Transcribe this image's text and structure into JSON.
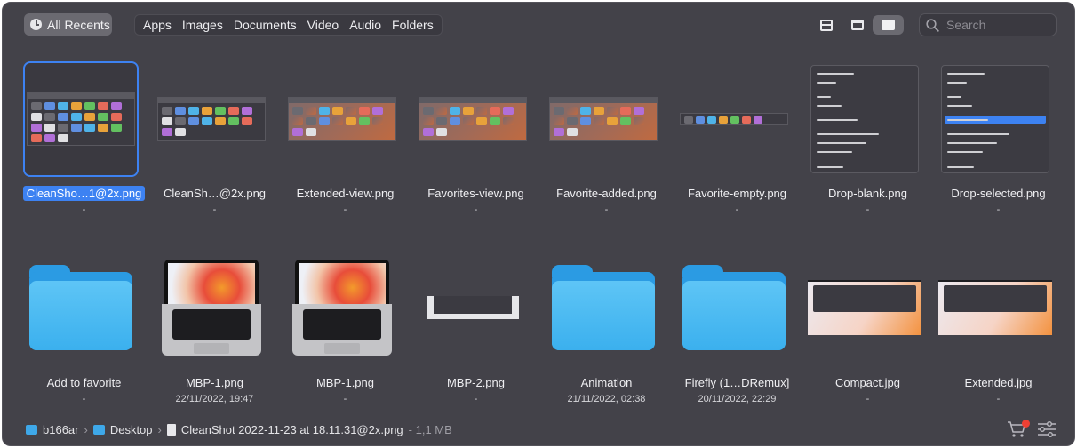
{
  "toolbar": {
    "recents_label": "All Recents",
    "filters": [
      "Apps",
      "Images",
      "Documents",
      "Video",
      "Audio",
      "Folders"
    ],
    "search_placeholder": "Search",
    "active_view": "large-thumbnails"
  },
  "items": [
    {
      "name": "CleanSho…1@2x.png",
      "sub": "-",
      "kind": "shot-icons",
      "selected": true
    },
    {
      "name": "CleanSh…@2x.png",
      "sub": "-",
      "kind": "shot"
    },
    {
      "name": "Extended-view.png",
      "sub": "-",
      "kind": "shot-warm"
    },
    {
      "name": "Favorites-view.png",
      "sub": "-",
      "kind": "shot-warm"
    },
    {
      "name": "Favorite-added.png",
      "sub": "-",
      "kind": "shot-warm"
    },
    {
      "name": "Favorite-empty.png",
      "sub": "-",
      "kind": "strip"
    },
    {
      "name": "Drop-blank.png",
      "sub": "-",
      "kind": "context-menu"
    },
    {
      "name": "Drop-selected.png",
      "sub": "-",
      "kind": "context-menu-highlight"
    },
    {
      "name": "Add to favorite",
      "sub": "-",
      "kind": "folder"
    },
    {
      "name": "MBP-1.png",
      "sub": "22/11/2022, 19:47",
      "kind": "laptop"
    },
    {
      "name": "MBP-1.png",
      "sub": "-",
      "kind": "laptop"
    },
    {
      "name": "MBP-2.png",
      "sub": "-",
      "kind": "flat"
    },
    {
      "name": "Animation",
      "sub": "21/11/2022, 02:38",
      "kind": "folder"
    },
    {
      "name": "Firefly (1…DRemux]",
      "sub": "20/11/2022, 22:29",
      "kind": "folder"
    },
    {
      "name": "Compact.jpg",
      "sub": "-",
      "kind": "wide"
    },
    {
      "name": "Extended.jpg",
      "sub": "-",
      "kind": "wide"
    }
  ],
  "context_menu": [
    "Show in Finder",
    "Open",
    "Copy",
    "Copy path",
    "Add to Favorites",
    "Ignore files with extension: .png",
    "Ignore file: MBP-1.png",
    "Ignore files in",
    "Move to Bin"
  ],
  "pathbar": {
    "segments": [
      "b166ar",
      "Desktop"
    ],
    "file": "CleanShot 2022-11-23 at 18.11.31@2x.png",
    "size": " - 1,1 MB"
  },
  "colors": {
    "background": "#434249",
    "selection": "#3d82f2",
    "folder": "#3bb0ee",
    "badge": "#ee4034"
  },
  "icons": [
    "clock-icon",
    "rows-view-icon",
    "top-bar-view-icon",
    "thumbnail-view-icon",
    "search-icon",
    "folder-icon",
    "document-icon",
    "cart-icon",
    "sliders-icon"
  ]
}
